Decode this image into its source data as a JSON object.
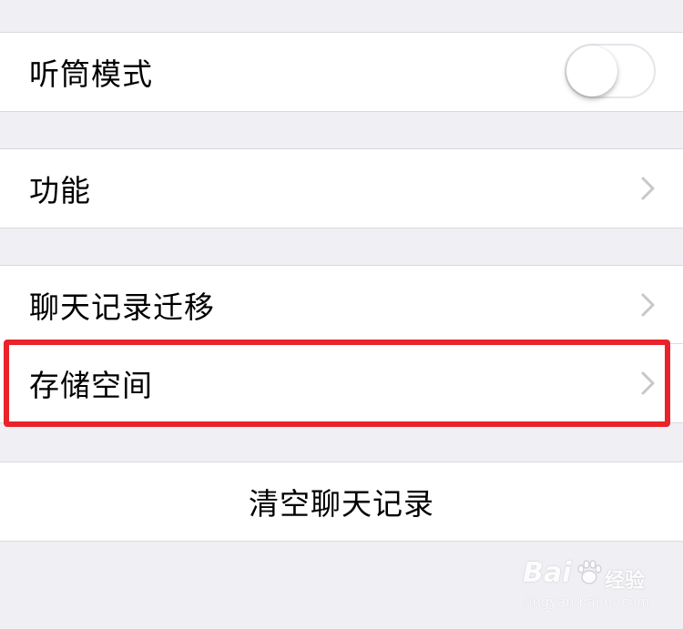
{
  "settings": {
    "earpiece_mode": {
      "label": "听筒模式",
      "toggle_on": false
    },
    "features": {
      "label": "功能"
    },
    "chat_migration": {
      "label": "聊天记录迁移"
    },
    "storage": {
      "label": "存储空间"
    },
    "clear_history": {
      "label": "清空聊天记录"
    }
  },
  "annotation": {
    "highlight_color": "#e8232b"
  },
  "watermark": {
    "brand": "Bai",
    "brand_suffix": "经验",
    "url": "jingyan.baidu.com"
  },
  "colors": {
    "background": "#efeff4",
    "row_background": "#ffffff",
    "chevron": "#c7c7cc"
  }
}
